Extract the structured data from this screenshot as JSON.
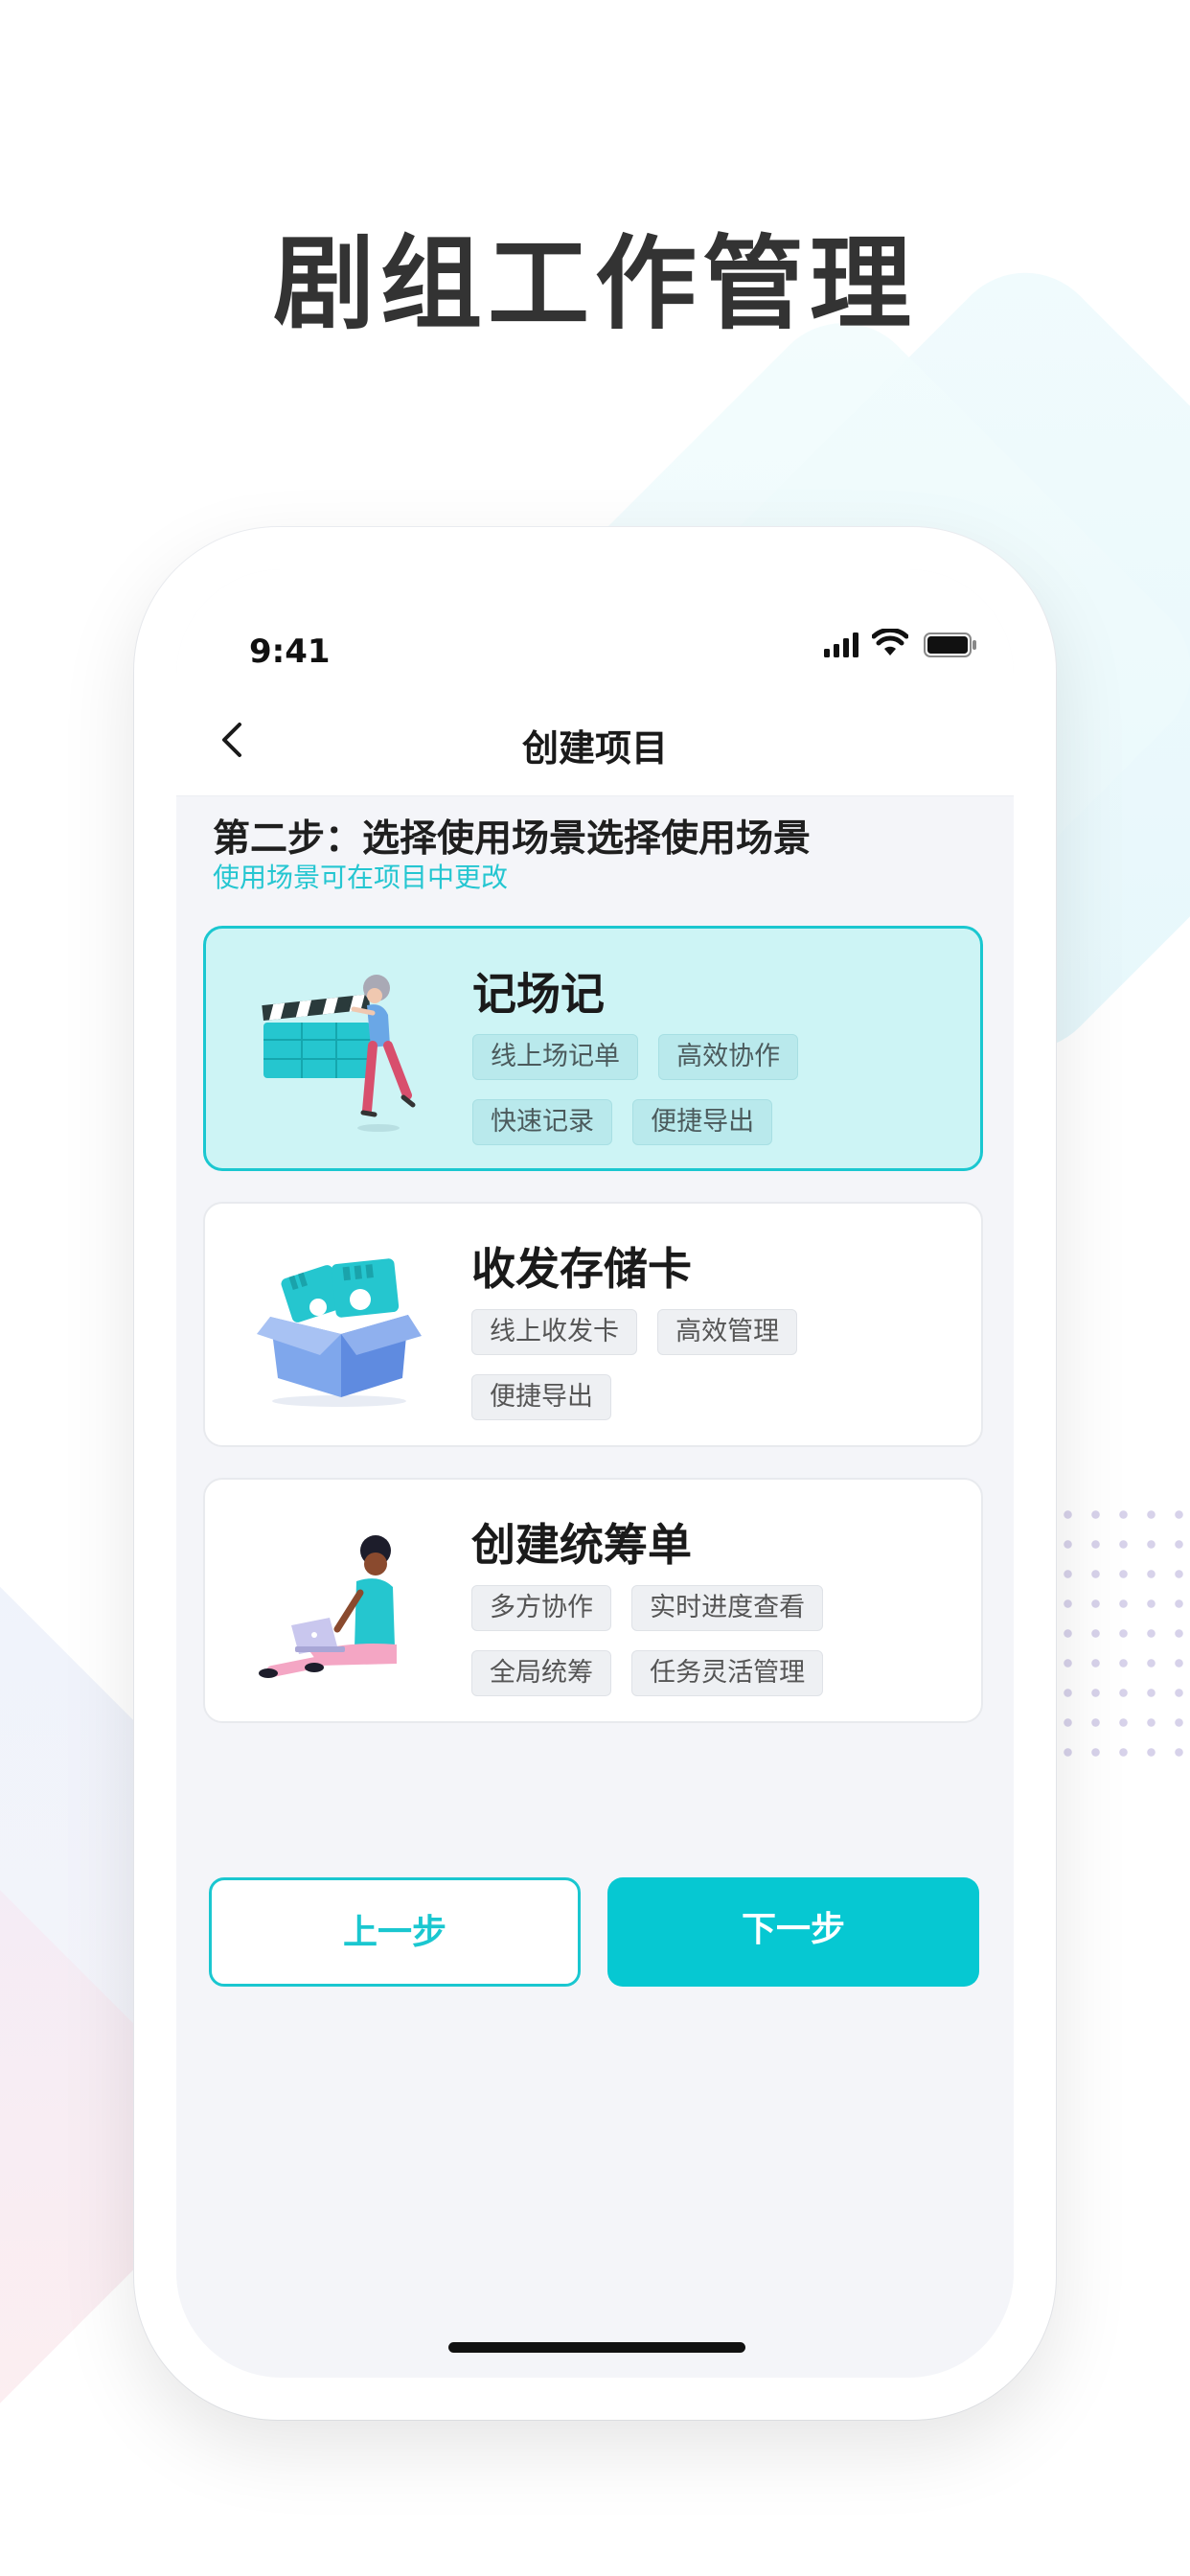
{
  "hero": {
    "title": "剧组工作管理"
  },
  "status_bar": {
    "time": "9:41"
  },
  "nav": {
    "title": "创建项目",
    "back_icon": "chevron-left-icon"
  },
  "step": {
    "title": "第二步：选择使用场景选择使用场景",
    "subtitle": "使用场景可在项目中更改"
  },
  "scenarios": [
    {
      "title": "记场记",
      "tags": [
        "线上场记单",
        "高效协作",
        "快速记录",
        "便捷导出"
      ],
      "selected": true,
      "icon": "clapperboard-illustration"
    },
    {
      "title": "收发存储卡",
      "tags": [
        "线上收发卡",
        "高效管理",
        "便捷导出"
      ],
      "selected": false,
      "icon": "memory-card-box-illustration"
    },
    {
      "title": "创建统筹单",
      "tags": [
        "多方协作",
        "实时进度查看",
        "全局统筹",
        "任务灵活管理"
      ],
      "selected": false,
      "icon": "person-laptop-illustration"
    }
  ],
  "buttons": {
    "prev": "上一步",
    "next": "下一步"
  },
  "colors": {
    "accent": "#06c8d2",
    "selected_bg": "#cdf4f5",
    "background": "#f4f5f9"
  }
}
